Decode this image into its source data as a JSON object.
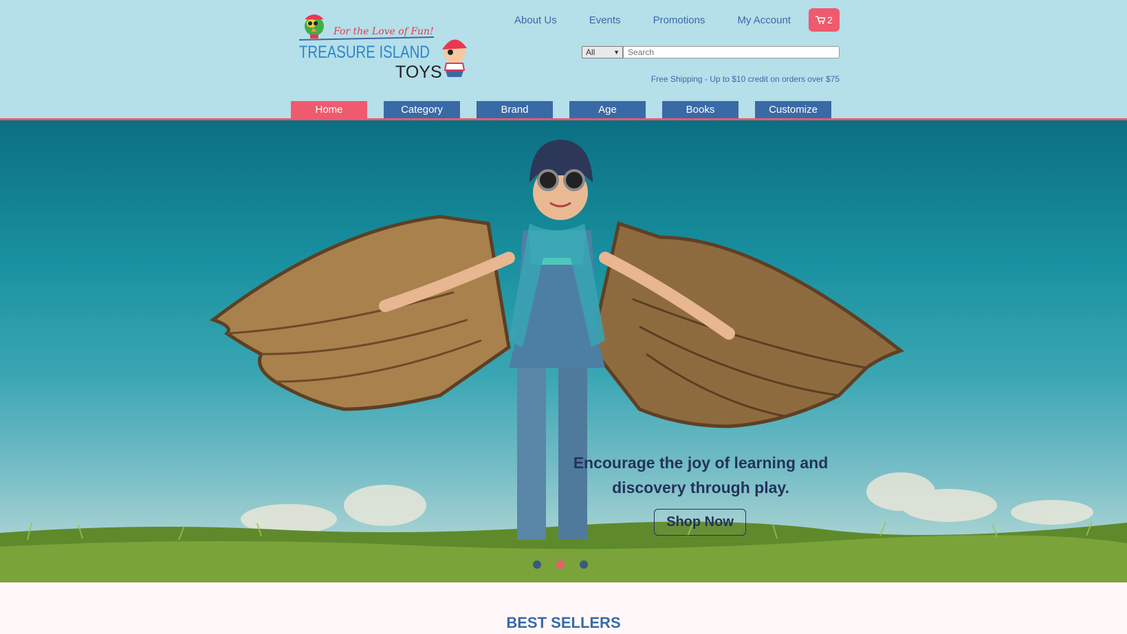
{
  "brand": {
    "tagline": "For the Love of Fun!",
    "name_line1": "TREASURE ISLAND",
    "name_line2": "TOYS"
  },
  "top_links": [
    "About Us",
    "Events",
    "Promotions",
    "My Account"
  ],
  "cart": {
    "count": "2",
    "icon": "cart-icon",
    "color": "#ef5a6f"
  },
  "search": {
    "category": "All",
    "placeholder": "Search"
  },
  "shipping_notice": "Free Shipping - Up to $10 credit on orders over $75",
  "nav": [
    "Home",
    "Category",
    "Brand",
    "Age",
    "Books",
    "Customize"
  ],
  "nav_active": "Home",
  "hero": {
    "headline": "Encourage the joy of learning and discovery through play.",
    "button": "Shop Now",
    "slides": 3,
    "active_slide": 2
  },
  "sections": {
    "best_sellers": "BEST SELLERS"
  },
  "colors": {
    "header_bg": "#b5dfe9",
    "nav_blue": "#3a6aa6",
    "accent_pink": "#ef5a6f",
    "hero_text": "#23335a"
  }
}
